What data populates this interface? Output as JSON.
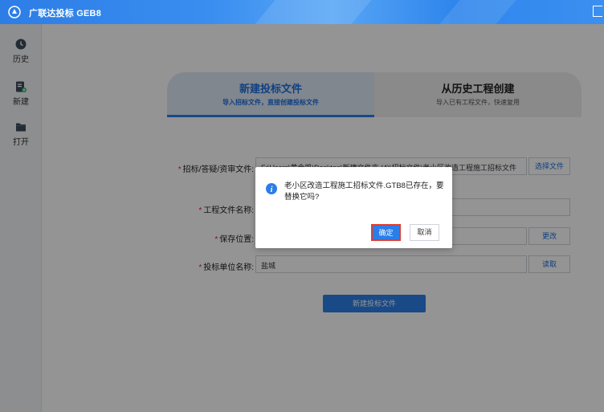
{
  "app": {
    "title": "广联达投标 GEB8"
  },
  "sidebar": {
    "items": [
      {
        "label": "历史",
        "icon": "history-icon"
      },
      {
        "label": "新建",
        "icon": "new-file-icon"
      },
      {
        "label": "打开",
        "icon": "folder-open-icon"
      }
    ]
  },
  "tabs": [
    {
      "title": "新建投标文件",
      "subtitle": "导入招标文件，直接创建投标文件",
      "active": true
    },
    {
      "title": "从历史工程创建",
      "subtitle": "导入已有工程文件，快速复用",
      "active": false
    }
  ],
  "form": {
    "tender_file": {
      "label": "招标/答疑/资审文件:",
      "value": "F:\\Users\\黄金凯\\Desktop\\新建文件夹 (4)\\招标文件\\老小区改造工程施工招标文件",
      "button": "选择文件"
    },
    "project_name": {
      "label": "工程文件名称:",
      "value": ""
    },
    "save_location": {
      "label": "保存位置:",
      "value": "",
      "button": "更改"
    },
    "bidder_name": {
      "label": "投标单位名称:",
      "value": "盐城",
      "button": "读取"
    },
    "submit_label": "新建投标文件"
  },
  "dialog": {
    "message": "老小区改造工程施工招标文件.GTB8已存在，要替换它吗?",
    "ok_label": "确定",
    "cancel_label": "取消"
  },
  "colors": {
    "accent": "#2b7ee8",
    "highlight": "#e23b30",
    "required": "#e22233"
  }
}
